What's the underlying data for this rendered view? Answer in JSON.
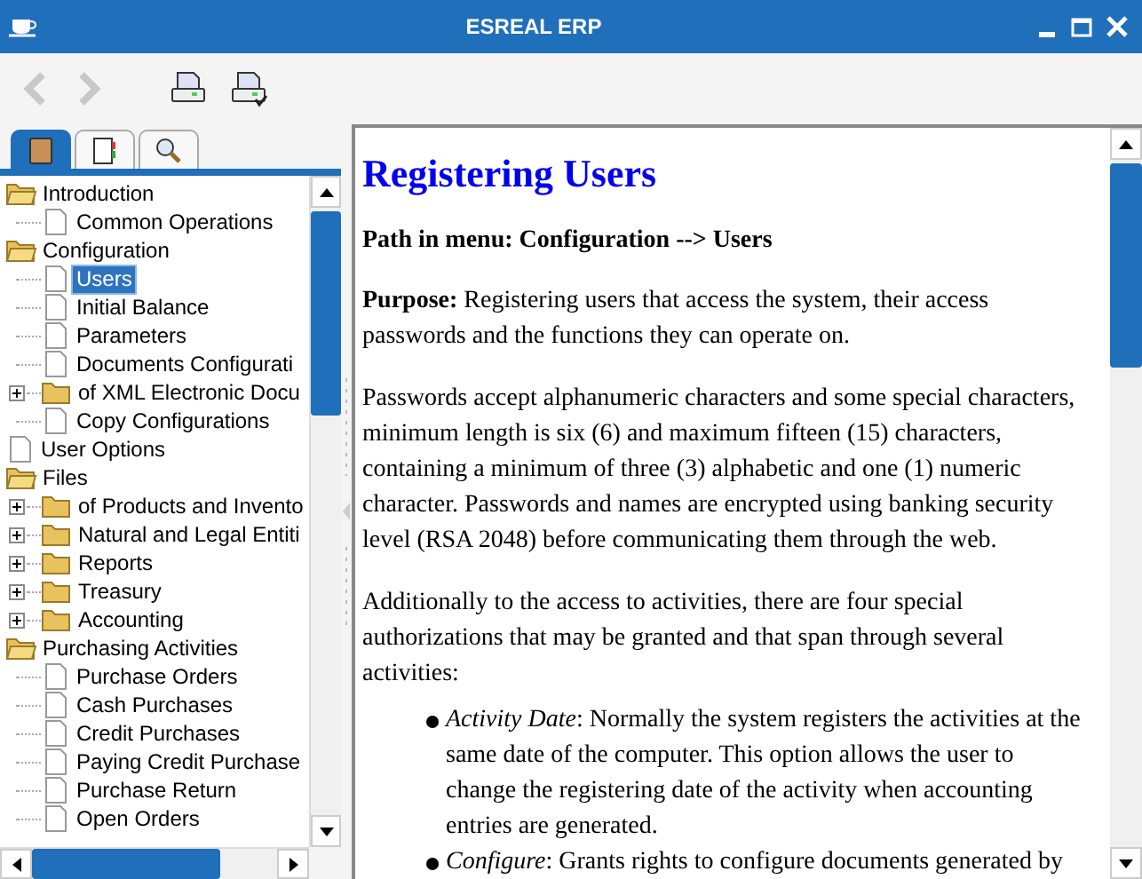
{
  "window": {
    "title": "ESREAL ERP"
  },
  "toolbar": [
    {
      "kind": "back",
      "disabled": true
    },
    {
      "kind": "forward",
      "disabled": true
    },
    {
      "kind": "print",
      "disabled": false
    },
    {
      "kind": "print-preview",
      "disabled": false
    }
  ],
  "tabs": [
    {
      "kind": "contents",
      "selected": true
    },
    {
      "kind": "index",
      "selected": false
    },
    {
      "kind": "search",
      "selected": false
    }
  ],
  "tree": [
    {
      "label": "Introduction",
      "kind": "folder",
      "expanded": true,
      "selected": false,
      "children": [
        {
          "label": "Common Operations",
          "kind": "doc",
          "selected": false
        }
      ]
    },
    {
      "label": "Configuration",
      "kind": "folder",
      "expanded": true,
      "selected": false,
      "children": [
        {
          "label": "Users",
          "kind": "doc",
          "selected": true
        },
        {
          "label": "Initial Balance",
          "kind": "doc",
          "selected": false
        },
        {
          "label": "Parameters",
          "kind": "doc",
          "selected": false
        },
        {
          "label": "Documents Configurati",
          "kind": "doc",
          "selected": false
        },
        {
          "label": "of XML Electronic Docu",
          "kind": "folder",
          "expanded": false,
          "selected": false
        },
        {
          "label": "Copy Configurations",
          "kind": "doc",
          "selected": false
        }
      ]
    },
    {
      "label": "User Options",
      "kind": "doc",
      "selected": false
    },
    {
      "label": "Files",
      "kind": "folder",
      "expanded": true,
      "selected": false,
      "children": [
        {
          "label": "of Products and Invento",
          "kind": "folder",
          "expanded": false,
          "selected": false
        },
        {
          "label": "Natural and Legal Entiti",
          "kind": "folder",
          "expanded": false,
          "selected": false
        },
        {
          "label": "Reports",
          "kind": "folder",
          "expanded": false,
          "selected": false
        },
        {
          "label": "Treasury",
          "kind": "folder",
          "expanded": false,
          "selected": false
        },
        {
          "label": "Accounting",
          "kind": "folder",
          "expanded": false,
          "selected": false
        }
      ]
    },
    {
      "label": "Purchasing Activities",
      "kind": "folder",
      "expanded": true,
      "selected": false,
      "children": [
        {
          "label": "Purchase Orders",
          "kind": "doc",
          "selected": false
        },
        {
          "label": "Cash Purchases",
          "kind": "doc",
          "selected": false
        },
        {
          "label": "Credit Purchases",
          "kind": "doc",
          "selected": false
        },
        {
          "label": "Paying Credit Purchase",
          "kind": "doc",
          "selected": false
        },
        {
          "label": "Purchase Return",
          "kind": "doc",
          "selected": false
        },
        {
          "label": "Open Orders",
          "kind": "doc",
          "selected": false
        }
      ]
    }
  ],
  "document": {
    "title": "Registering Users",
    "blocks": [
      {
        "kind": "path",
        "text": "Path in menu: Configuration --> Users"
      },
      {
        "kind": "paragraph",
        "text": "**Purpose:** Registering users that access the system, their access passwords and the functions they can operate on."
      },
      {
        "kind": "paragraph",
        "text": "Passwords accept alphanumeric characters and some special characters, minimum length is six (6) and maximum fifteen (15) characters, containing a minimum of three (3) alphabetic and one (1) numeric character. Passwords and names are encrypted using banking security level (RSA 2048) before communicating them through the web."
      },
      {
        "kind": "paragraph",
        "text": "Additionally to the access to activities, there are four special authorizations that may be granted and that span through several activities:"
      },
      {
        "kind": "bullet",
        "text": "*Activity Date*: Normally the system registers the activities at the same date of the computer. This option allows the user to change the registering date of the activity when accounting entries are generated."
      },
      {
        "kind": "bullet",
        "text": "*Configure*: Grants rights to configure documents generated by"
      }
    ]
  }
}
